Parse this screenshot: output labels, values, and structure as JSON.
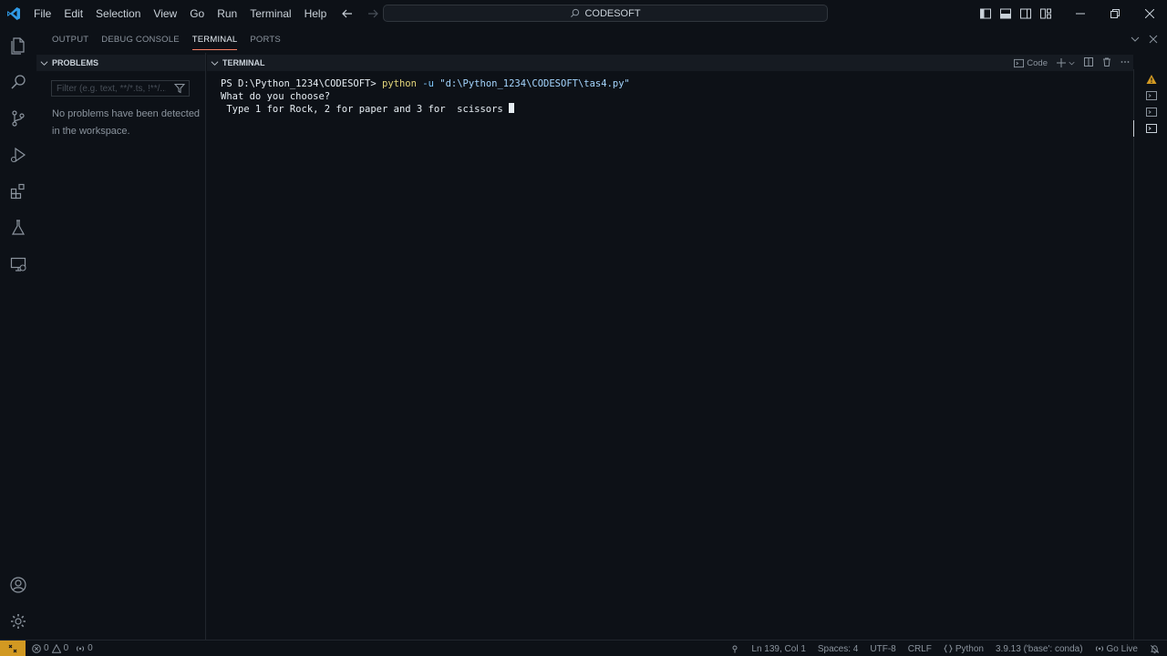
{
  "app": {
    "title": "CODESOFT",
    "accent": "#007acc"
  },
  "menu": [
    "File",
    "Edit",
    "Selection",
    "View",
    "Go",
    "Run",
    "Terminal",
    "Help"
  ],
  "panel_tabs": [
    {
      "label": "OUTPUT",
      "active": false
    },
    {
      "label": "DEBUG CONSOLE",
      "active": false
    },
    {
      "label": "TERMINAL",
      "active": true
    },
    {
      "label": "PORTS",
      "active": false
    }
  ],
  "problems": {
    "header": "PROBLEMS",
    "filter_placeholder": "Filter (e.g. text, **/*.ts, !**/...",
    "message": "No problems have been detected in the workspace."
  },
  "terminal": {
    "header": "TERMINAL",
    "profile": "Code",
    "prompt": "PS D:\\Python_1234\\CODESOFT> ",
    "command": "python",
    "flag": " -u ",
    "arg": "\"d:\\Python_1234\\CODESOFT\\tas4.py\"",
    "output_line1": "What do you choose?",
    "output_line2": " Type 1 for Rock, 2 for paper and 3 for  scissors "
  },
  "status": {
    "errors": "0",
    "warnings": "0",
    "ports": "0",
    "position": "Ln 139, Col 1",
    "spaces": "Spaces: 4",
    "encoding": "UTF-8",
    "eol": "CRLF",
    "language": "Python",
    "interpreter": "3.9.13 ('base': conda)",
    "golive": "Go Live"
  },
  "colors": {
    "warning": "#d29922",
    "active_tab_underline": "#f78166",
    "remote_bg": "#d29922"
  }
}
